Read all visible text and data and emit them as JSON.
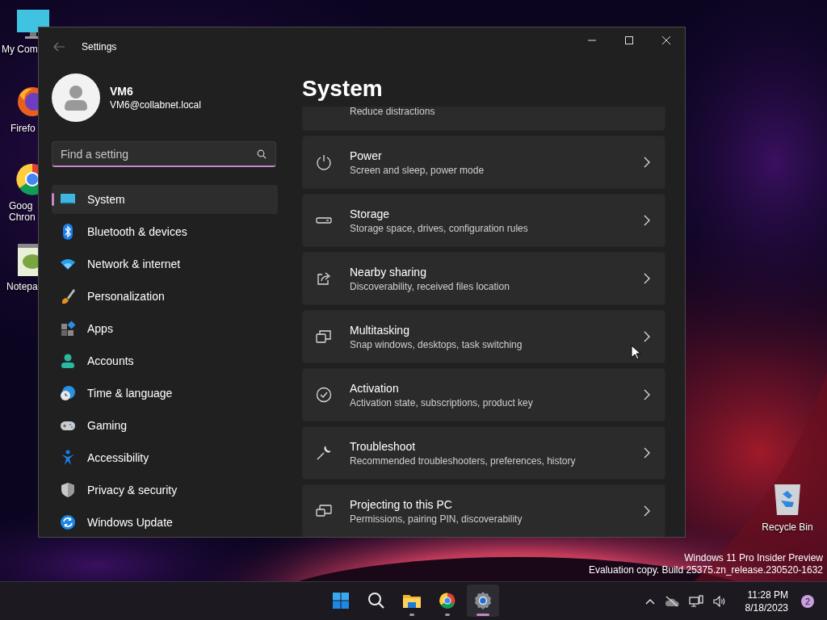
{
  "desktop": {
    "icons": [
      {
        "kind": "monitor",
        "lines": [
          "My Com"
        ]
      },
      {
        "kind": "firefox",
        "lines": [
          "Firefo"
        ]
      },
      {
        "kind": "chrome",
        "lines": [
          "Goog",
          "Chron"
        ]
      },
      {
        "kind": "notepad",
        "lines": [
          "Notepa"
        ]
      }
    ],
    "recycle_bin": {
      "label": "Recycle Bin"
    },
    "notice": [
      "Windows 11 Pro Insider Preview",
      "Evaluation copy. Build 25375.zn_release.230520-1632"
    ]
  },
  "window": {
    "title": "Settings",
    "account": {
      "name": "VM6",
      "email": "VM6@collabnet.local"
    },
    "search": {
      "placeholder": "Find a setting"
    },
    "nav": [
      {
        "kind": "system",
        "label": "System",
        "selected": true
      },
      {
        "kind": "bluetooth",
        "label": "Bluetooth & devices",
        "selected": false
      },
      {
        "kind": "network",
        "label": "Network & internet",
        "selected": false
      },
      {
        "kind": "brush",
        "label": "Personalization",
        "selected": false
      },
      {
        "kind": "apps",
        "label": "Apps",
        "selected": false
      },
      {
        "kind": "accounts",
        "label": "Accounts",
        "selected": false
      },
      {
        "kind": "time",
        "label": "Time & language",
        "selected": false
      },
      {
        "kind": "gaming",
        "label": "Gaming",
        "selected": false
      },
      {
        "kind": "accessibility",
        "label": "Accessibility",
        "selected": false
      },
      {
        "kind": "privacy",
        "label": "Privacy & security",
        "selected": false
      },
      {
        "kind": "update",
        "label": "Windows Update",
        "selected": false
      }
    ],
    "page_title": "System",
    "settings": [
      {
        "kind": "partial",
        "subtitle": "Reduce distractions"
      },
      {
        "kind": "power",
        "title": "Power",
        "subtitle": "Screen and sleep, power mode"
      },
      {
        "kind": "storage",
        "title": "Storage",
        "subtitle": "Storage space, drives, configuration rules"
      },
      {
        "kind": "share",
        "title": "Nearby sharing",
        "subtitle": "Discoverability, received files location"
      },
      {
        "kind": "multitask",
        "title": "Multitasking",
        "subtitle": "Snap windows, desktops, task switching"
      },
      {
        "kind": "activation",
        "title": "Activation",
        "subtitle": "Activation state, subscriptions, product key"
      },
      {
        "kind": "troubleshoot",
        "title": "Troubleshoot",
        "subtitle": "Recommended troubleshooters, preferences, history"
      },
      {
        "kind": "project",
        "title": "Projecting to this PC",
        "subtitle": "Permissions, pairing PIN, discoverability"
      }
    ]
  },
  "taskbar": {
    "apps": [
      {
        "kind": "start",
        "running": false,
        "selected": false
      },
      {
        "kind": "search",
        "running": false,
        "selected": false
      },
      {
        "kind": "explorer",
        "running": true,
        "selected": false
      },
      {
        "kind": "chrome",
        "running": true,
        "selected": false
      },
      {
        "kind": "settings",
        "running": true,
        "selected": true
      }
    ],
    "time": "11:28 PM",
    "date": "8/18/2023",
    "notifications": "2"
  }
}
